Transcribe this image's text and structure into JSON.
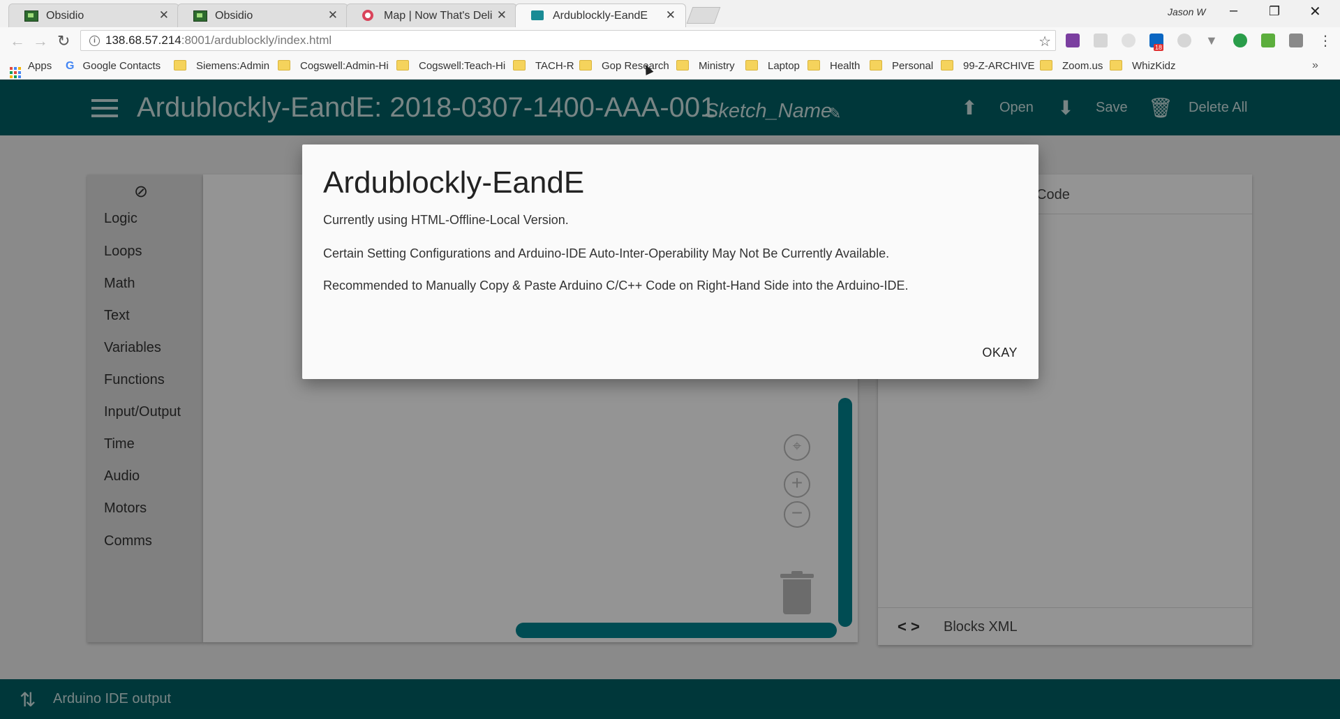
{
  "browser": {
    "tabs": [
      {
        "title": "Obsidio",
        "favicon": "obsidio-icon"
      },
      {
        "title": "Obsidio",
        "favicon": "obsidio-icon"
      },
      {
        "title": "Map | Now That's Delicio",
        "favicon": "map-pin-icon"
      },
      {
        "title": "Ardublockly-EandE",
        "favicon": "blockly-icon",
        "active": true
      }
    ],
    "close_glyph": "✕",
    "profile_name": "Jason W",
    "url_host": "138.68.57.214",
    "url_path": ":8001/ardublockly/index.html",
    "extension_badge": "18",
    "bookmarks": [
      {
        "label": "Apps",
        "icon": "apps-icon"
      },
      {
        "label": "Google Contacts",
        "icon": "google-icon"
      },
      {
        "label": "Siemens:Admin",
        "icon": "folder-icon"
      },
      {
        "label": "Cogswell:Admin-Hi",
        "icon": "folder-icon"
      },
      {
        "label": "Cogswell:Teach-Hi",
        "icon": "folder-icon"
      },
      {
        "label": "TACH-R",
        "icon": "folder-icon"
      },
      {
        "label": "Gop Research",
        "icon": "folder-icon"
      },
      {
        "label": "Ministry",
        "icon": "folder-icon"
      },
      {
        "label": "Laptop",
        "icon": "folder-icon"
      },
      {
        "label": "Health",
        "icon": "folder-icon"
      },
      {
        "label": "Personal",
        "icon": "folder-icon"
      },
      {
        "label": "99-Z-ARCHIVE",
        "icon": "folder-icon"
      },
      {
        "label": "Zoom.us",
        "icon": "folder-icon"
      },
      {
        "label": "WhizKidz",
        "icon": "folder-icon"
      }
    ],
    "bookmarks_more": "»"
  },
  "app": {
    "title": "Ardublockly-EandE: 2018-0307-1400-AAA-001",
    "sketch_name": "Sketch_Name",
    "actions": {
      "open": "Open",
      "save": "Save",
      "delete_all": "Delete All"
    },
    "toolbox": [
      "Logic",
      "Loops",
      "Math",
      "Text",
      "Variables",
      "Functions",
      "Input/Output",
      "Time",
      "Audio",
      "Motors",
      "Comms"
    ],
    "code_panel_title": "Code",
    "xml_icon": "< >",
    "xml_label": "Blocks XML",
    "footer_label": "Arduino IDE output",
    "colors": {
      "primary": "#006064",
      "accent": "#00838f"
    }
  },
  "dialog": {
    "title": "Ardublockly-EandE",
    "lines": [
      "Currently using HTML-Offline-Local Version.",
      "Certain Setting Configurations and Arduino-IDE Auto-Inter-Operability May Not Be Currently Available.",
      "Recommended to Manually Copy & Paste Arduino C/C++ Code on Right-Hand Side into the Arduino-IDE."
    ],
    "ok_label": "OKAY"
  }
}
